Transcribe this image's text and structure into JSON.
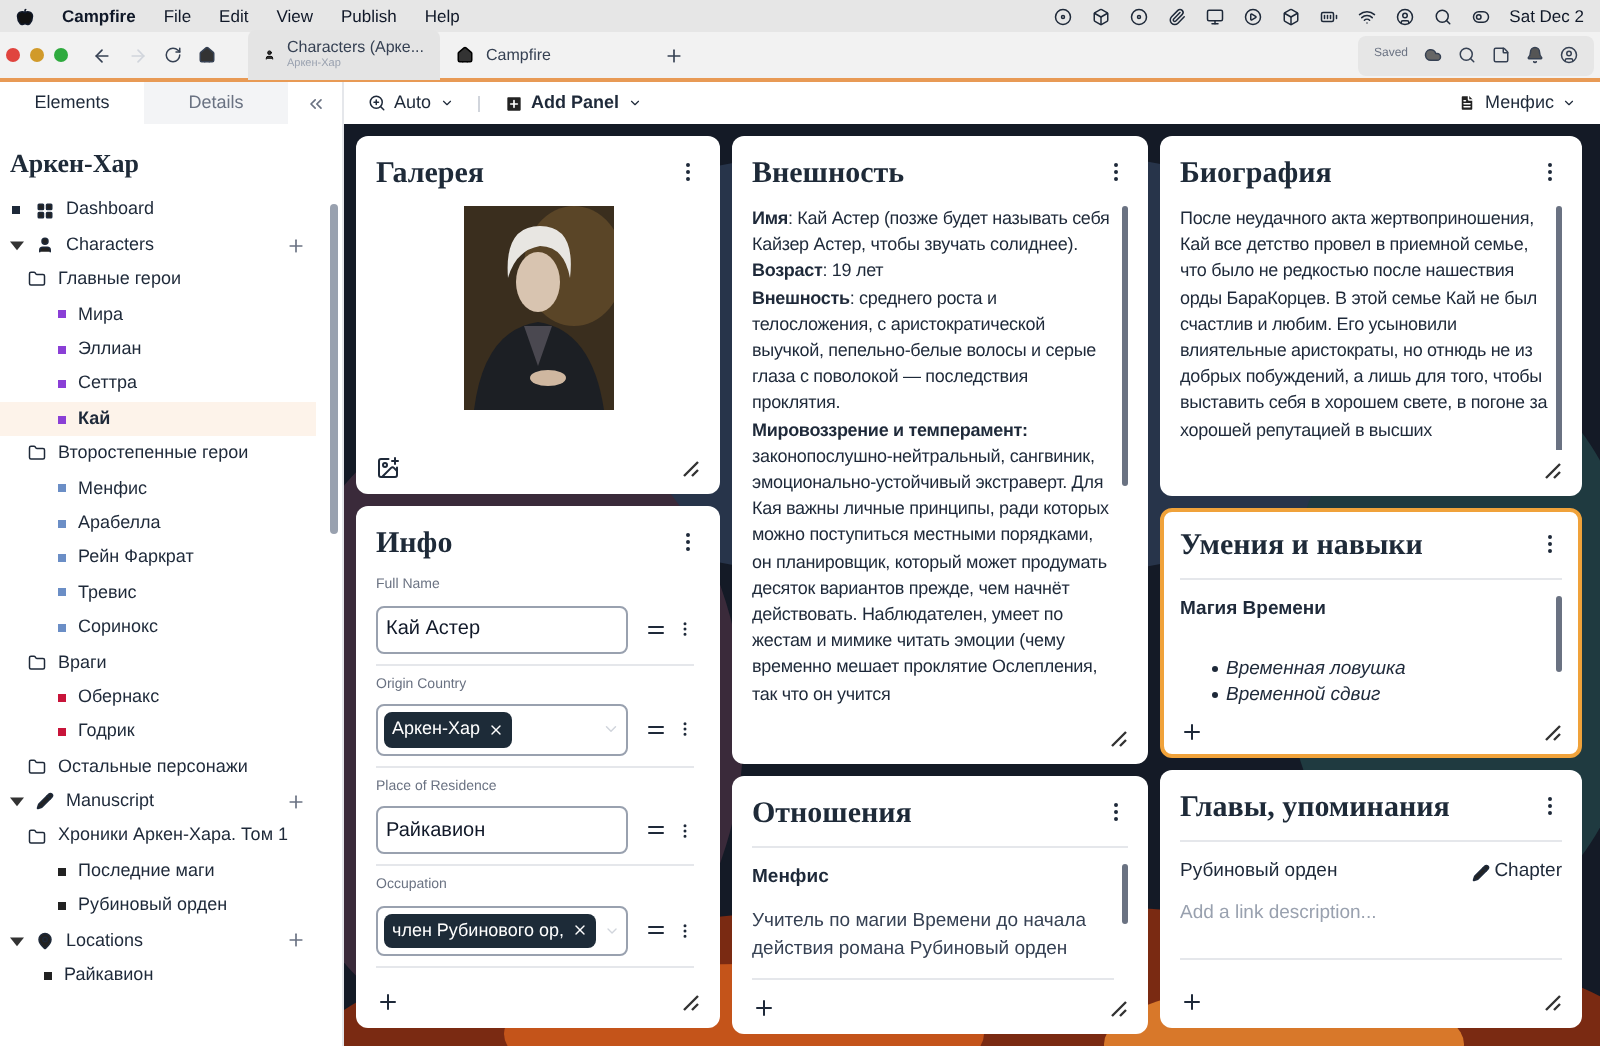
{
  "menubar": {
    "app": "Campfire",
    "menus": [
      "File",
      "Edit",
      "View",
      "Publish",
      "Help"
    ],
    "clock": "Sat Dec 2"
  },
  "browser": {
    "tabs": [
      {
        "title": "Characters (Арке...",
        "subtitle": "Аркен-Хар",
        "selected": true
      },
      {
        "title": "Campfire",
        "selected": false
      }
    ],
    "saved": "Saved"
  },
  "sidebar": {
    "tabs": [
      {
        "label": "Elements",
        "selected": true
      },
      {
        "label": "Details",
        "selected": false
      }
    ],
    "title": "Аркен-Хар",
    "sections": [
      {
        "label": "Dashboard",
        "kind": "link"
      },
      {
        "label": "Characters",
        "kind": "group",
        "expanded": true,
        "children": [
          {
            "label": "Главные герои",
            "children": [
              {
                "label": "Мира",
                "color": "#8a3fd6",
                "selected": false
              },
              {
                "label": "Эллиан",
                "color": "#8a3fd6",
                "selected": false
              },
              {
                "label": "Сеттра",
                "color": "#8a3fd6",
                "selected": false
              },
              {
                "label": "Кай",
                "color": "#8a3fd6",
                "selected": true
              }
            ]
          },
          {
            "label": "Второстепенные герои",
            "children": [
              {
                "label": "Менфис",
                "color": "#6b8ec6",
                "selected": false
              },
              {
                "label": "Арабелла",
                "color": "#6b8ec6",
                "selected": false
              },
              {
                "label": "Рейн Фаркрат",
                "color": "#6b8ec6",
                "selected": false
              },
              {
                "label": "Тревис",
                "color": "#6b8ec6",
                "selected": false
              },
              {
                "label": "Соринокс",
                "color": "#6b8ec6",
                "selected": false
              }
            ]
          },
          {
            "label": "Враги",
            "children": [
              {
                "label": "Обернакс",
                "color": "#c8143a",
                "selected": false
              },
              {
                "label": "Годрик",
                "color": "#c8143a",
                "selected": false
              }
            ]
          },
          {
            "label": "Остальные персонажи"
          }
        ]
      },
      {
        "label": "Manuscript",
        "kind": "group",
        "expanded": true,
        "children": [
          {
            "label": "Хроники Аркен-Хара. Том 1",
            "children": [
              {
                "label": "Последние маги",
                "color": "#222222",
                "selected": false
              },
              {
                "label": "Рубиновый орден",
                "color": "#222222",
                "selected": false
              }
            ]
          }
        ]
      },
      {
        "label": "Locations",
        "kind": "group",
        "expanded": true,
        "children": [
          {
            "label": "Райкавион",
            "color": "#222222",
            "selected": false
          }
        ]
      }
    ]
  },
  "toolbar": {
    "zoom": "Auto",
    "add_panel": "Add Panel",
    "character": "Менфис"
  },
  "columns": [
    [
      {
        "kind": "gallery",
        "title": "Галерея",
        "focused": false
      },
      {
        "kind": "fields",
        "title": "Инфо",
        "focused": false,
        "fields": [
          {
            "label": "Full Name",
            "kind": "text",
            "value": "Кай Астер"
          },
          {
            "label": "Origin Country",
            "kind": "tags",
            "tags": [
              "Аркен-Хар"
            ]
          },
          {
            "label": "Place of Residence",
            "kind": "text",
            "value": "Райкавион"
          },
          {
            "label": "Occupation",
            "kind": "tags",
            "tags": [
              "член Рубинового ор,"
            ]
          }
        ]
      }
    ],
    [
      {
        "kind": "richtext",
        "title": "Внешность",
        "focused": false,
        "paragraphs": [
          "**Имя**: Кай Астер (позже будет называть себя Кайзер Астер, чтобы звучать солиднее).",
          "**Возраст**: 19 лет",
          "**Внешность**: среднего роста и телосложения, с аристократической выучкой, пепельно-белые волосы и серые глаза с поволокой — последствия проклятия.",
          "**Мировоззрение и темперамент:** законопослушно-нейтральный, сангвиник, эмоционально-устойчивый экстраверт. Для Кая важны личные принципы, ради которых можно поступиться местными порядками, он планировщик, который может продумать десяток вариантов прежде, чем начнёт действовать. Наблюдателен, умеет по жестам и мимике читать эмоции (чему временно мешает проклятие Ослепления, так что он учится"
        ]
      },
      {
        "kind": "relations",
        "title": "Отношения",
        "focused": false,
        "entries": [
          {
            "name": "Менфис",
            "text": "Учитель по магии Времени до начала действия романа Рубиновый орден"
          }
        ]
      }
    ],
    [
      {
        "kind": "richtext",
        "title": "Биография",
        "focused": false,
        "paragraphs": [
          "После неудачного акта жертвоприношения, Кай все детство провел в приемной семье, что было не редкостью после нашествия орды БараКорцев. В этой семье Кай не был счастлив и любим. Его усыновили влиятельные аристократы, но отнюдь не из добрых побуждений, а лишь для того, чтобы выставить себя в хорошем свете, в погоне за хорошей репутацией в высших"
        ]
      },
      {
        "kind": "skills",
        "title": "Умения и навыки",
        "focused": true,
        "heading": "Магия Времени",
        "bullets": [
          "Временная ловушка",
          "Временной сдвиг"
        ]
      },
      {
        "kind": "links",
        "title": "Главы, упоминания",
        "focused": false,
        "links": [
          {
            "name": "Рубиновый орден",
            "button": "Chapter",
            "placeholder": "Add a link description..."
          }
        ]
      }
    ]
  ]
}
